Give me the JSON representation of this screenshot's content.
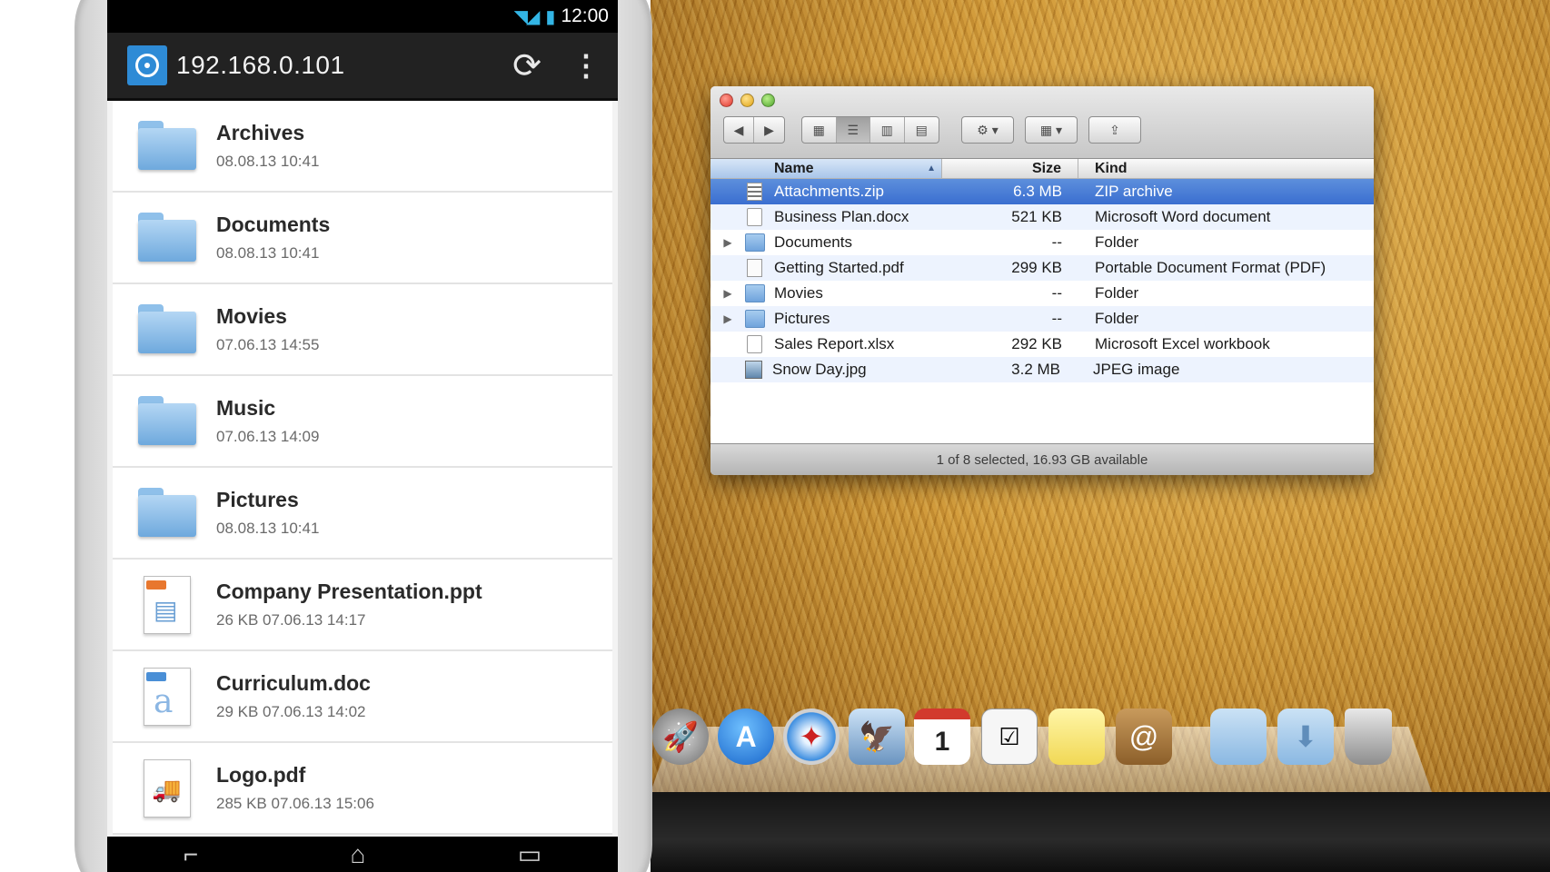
{
  "phone": {
    "status_bar": {
      "time": "12:00"
    },
    "action_bar": {
      "title": "192.168.0.101"
    },
    "files": [
      {
        "name": "Archives",
        "meta": "08.08.13 10:41",
        "icon": "folder-icon"
      },
      {
        "name": "Documents",
        "meta": "08.08.13 10:41",
        "icon": "folder-icon"
      },
      {
        "name": "Movies",
        "meta": "07.06.13 14:55",
        "icon": "folder-icon"
      },
      {
        "name": "Music",
        "meta": "07.06.13 14:09",
        "icon": "folder-icon"
      },
      {
        "name": "Pictures",
        "meta": "08.08.13 10:41",
        "icon": "folder-icon"
      },
      {
        "name": "Company Presentation.ppt",
        "meta": "26 KB 07.06.13 14:17",
        "icon": "presentation-icon"
      },
      {
        "name": "Curriculum.doc",
        "meta": "29 KB 07.06.13 14:02",
        "icon": "document-icon"
      },
      {
        "name": "Logo.pdf",
        "meta": "285 KB 07.06.13 15:06",
        "icon": "pdf-icon"
      }
    ]
  },
  "finder": {
    "columns": {
      "name": "Name",
      "size": "Size",
      "kind": "Kind"
    },
    "rows": [
      {
        "name": "Attachments.zip",
        "size": "6.3 MB",
        "kind": "ZIP archive",
        "selected": true
      },
      {
        "name": "Business Plan.docx",
        "size": "521 KB",
        "kind": "Microsoft Word document"
      },
      {
        "name": "Documents",
        "size": "--",
        "kind": "Folder"
      },
      {
        "name": "Getting Started.pdf",
        "size": "299 KB",
        "kind": "Portable Document Format (PDF)"
      },
      {
        "name": "Movies",
        "size": "--",
        "kind": "Folder"
      },
      {
        "name": "Pictures",
        "size": "--",
        "kind": "Folder"
      },
      {
        "name": "Sales Report.xlsx",
        "size": "292 KB",
        "kind": "Microsoft Excel workbook"
      },
      {
        "name": "Snow Day.jpg",
        "size": "3.2 MB",
        "kind": "JPEG image"
      }
    ],
    "status": "1 of 8 selected, 16.93 GB available"
  },
  "dock": {
    "items": [
      "launchpad-icon",
      "app-store-icon",
      "safari-icon",
      "preview-icon",
      "calendar-icon",
      "reminders-icon",
      "notes-icon",
      "contacts-icon",
      "documents-folder-icon",
      "downloads-folder-icon",
      "trash-icon"
    ],
    "calendar_day": "1"
  },
  "colors": {
    "accent": "#2e8bd6",
    "selection": "#3a6ed0",
    "status_signal": "#33b5e5"
  }
}
